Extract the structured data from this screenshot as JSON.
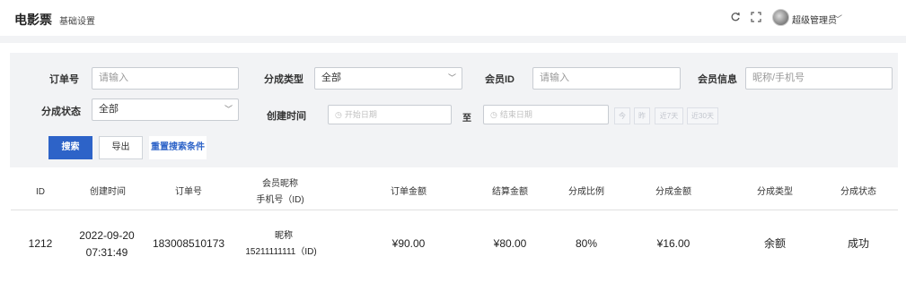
{
  "header": {
    "app_name": "电影票",
    "breadcrumb": "基础设置",
    "user_name": "超级管理员"
  },
  "filters": {
    "order_no": {
      "label": "订单号",
      "placeholder": "请输入"
    },
    "share_type": {
      "label": "分成类型",
      "value": "全部"
    },
    "member_id": {
      "label": "会员ID",
      "placeholder": "请输入"
    },
    "member_info": {
      "label": "会员信息",
      "placeholder": "昵称/手机号"
    },
    "share_status": {
      "label": "分成状态",
      "value": "全部"
    },
    "created_time": {
      "label": "创建时间",
      "start_placeholder": "开始日期",
      "separator": "至",
      "end_placeholder": "结束日期",
      "quick": [
        "今",
        "昨",
        "近7天",
        "近30天"
      ]
    }
  },
  "actions": {
    "search": "搜索",
    "export": "导出",
    "reset": "重置搜索条件"
  },
  "table": {
    "headers": {
      "id": "ID",
      "created": "创建时间",
      "order_no": "订单号",
      "member_line1": "会员昵称",
      "member_line2": "手机号（ID)",
      "order_amount": "订单金额",
      "settle_amount": "结算金额",
      "ratio": "分成比例",
      "share_amount": "分成金额",
      "share_type": "分成类型",
      "share_status": "分成状态"
    },
    "rows": [
      {
        "id": "1212",
        "date": "2022-09-20",
        "time": "07:31:49",
        "order_no": "183008510173",
        "nickname": "昵称",
        "phone": "15211111111（ID)",
        "order_amount": "¥90.00",
        "settle_amount": "¥80.00",
        "ratio": "80%",
        "share_amount": "¥16.00",
        "share_type": "余额",
        "share_status": "成功"
      }
    ]
  }
}
